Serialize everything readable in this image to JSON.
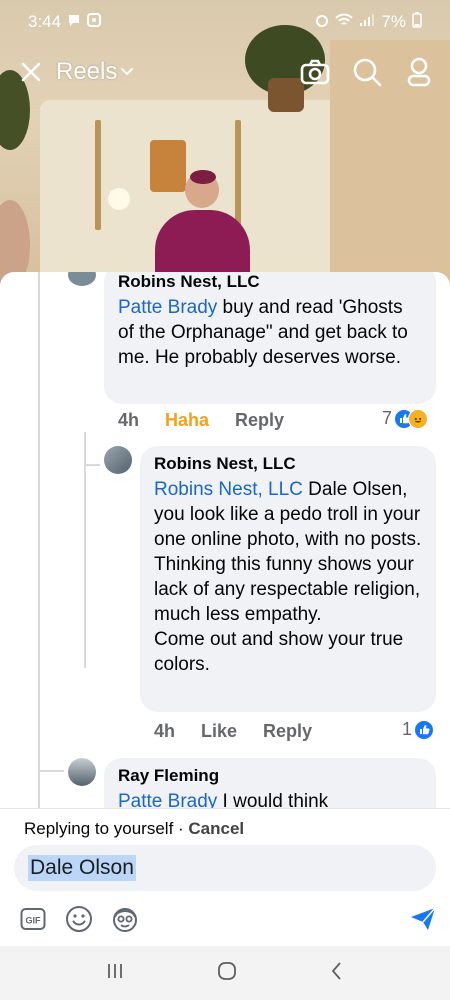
{
  "status_bar": {
    "time": "3:44",
    "battery": "7%"
  },
  "reels_header": {
    "title": "Reels",
    "icons": [
      "close-icon",
      "chevron-down-icon",
      "camera-icon",
      "search-icon",
      "profile-icon"
    ]
  },
  "comments": [
    {
      "author": "Robins Nest, LLC",
      "mention": "Patte Brady",
      "text": " buy and read 'Ghosts of the Orphanage\" and get back to me. He probably deserves worse.",
      "time": "4h",
      "reaction_label": "Haha",
      "reply_label": "Reply",
      "reaction_count": "7"
    },
    {
      "author": "Robins Nest, LLC",
      "mention": "Robins Nest, LLC",
      "text": " Dale Olsen, you look like a pedo troll in your one online photo, with no posts. Thinking this funny shows your lack of any respectable religion, much less empathy.\nCome out and show your true colors.",
      "time": "4h",
      "like_label": "Like",
      "reply_label": "Reply",
      "reaction_count": "1"
    },
    {
      "author": "Ray Fleming",
      "mention": "Patte Brady",
      "text": " I would think"
    }
  ],
  "composer": {
    "replying_prefix": "Replying to yourself · ",
    "cancel_label": "Cancel",
    "input_value": "Dale Olson",
    "icons": [
      "gif-icon",
      "emoji-icon",
      "avatar-sticker-icon",
      "send-icon"
    ]
  },
  "colors": {
    "link": "#1b66c9",
    "haha": "#f2a31b",
    "like_blue": "#1877f2",
    "bubble": "#f0f2f5"
  },
  "navbar": {
    "icons": [
      "recent-apps-icon",
      "home-icon",
      "back-icon"
    ]
  }
}
